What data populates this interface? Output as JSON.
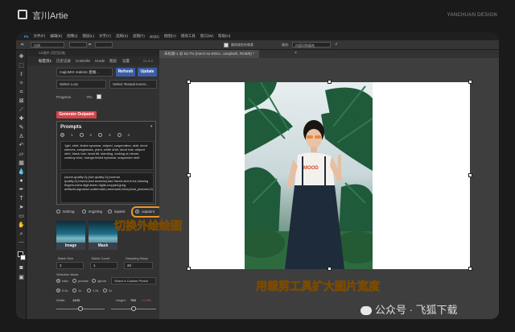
{
  "brand": {
    "name": "言川Artie",
    "right": "YANCHUAN DESIGN"
  },
  "menubar": [
    "文件(F)",
    "编辑(E)",
    "图像(I)",
    "图层(L)",
    "文字(Y)",
    "选择(S)",
    "滤镜(T)",
    "3D(D)",
    "视图(V)",
    "增效工具",
    "窗口(W)",
    "帮助(H)"
  ],
  "optionsbar": {
    "ratio": "比例",
    "delete_cropped": "删除裁剪的像素",
    "fill": "填充:",
    "fill_value": "内容识别填充"
  },
  "panel": {
    "title": "SD插件 (项目区域)",
    "tabs": [
      "标签页1",
      "历史记录",
      "ControlN",
      "Horde",
      "图层",
      "设置"
    ],
    "version": "v1.3.x",
    "model": "majicMIX realistic 麦橘...",
    "refresh": "Refresh",
    "update": "Update",
    "lora": "Select Lora",
    "textual": "Select Textual Invers...",
    "progress_label": "Progress",
    "progress_value": "0%",
    "generate": "Generate Outpaint",
    "prompts_title": "Prompts",
    "prompt_tabs": [
      "1",
      "2",
      "3",
      "4"
    ],
    "positive": "1girl, shirt, tinted eyewear, striped, suspenders, skirt, short sleeves, sunglasses, plant, white shirt, short hair, striped shirt, black hair, head tilt, standing, looking at viewer, cowboy shot, orange-tinted eyewear, suspender skirt",
    "negative": "(worst quality:2),(low quality:2),(normal quality:2),lowres,bad anatomy,bad hands,text,error,missing fingers,extra digit,fewer digits,cropped,jpeg artifacts,signature,watermark,username,blurry,bad_pictures,DeepNegativeV1.x_V175T,nsfw,",
    "modes": [
      "txt2img",
      "img2img",
      "inpaint",
      "outpaint"
    ],
    "image_label": "Image",
    "mask_label": "Mask",
    "batch_size_label": "Batch Size",
    "batch_size": "2",
    "batch_count_label": "Batch Count",
    "batch_count": "1",
    "steps_label": "Sampling Steps",
    "steps": "20",
    "selection_label": "Selection Mode",
    "sel_modes": [
      "ratio",
      "precise",
      "ignore"
    ],
    "preset": "Select a Custom Preset",
    "sizes": [
      "0.5x",
      "1x",
      "1.5x",
      "2x"
    ],
    "width_label": "Width:",
    "width": "1433",
    "height_label": "Height:",
    "height": "768",
    "link": "<=>Fit"
  },
  "document": {
    "tab": "未标题-1 @ 63.7% (merci-su-9XKx...unsplash, RGB/8) *"
  },
  "annotations": {
    "switch": "切换外绘绘图",
    "crop": "用裁剪工具扩大图片宽度"
  },
  "watermark": "公众号 · 飞狐下载"
}
